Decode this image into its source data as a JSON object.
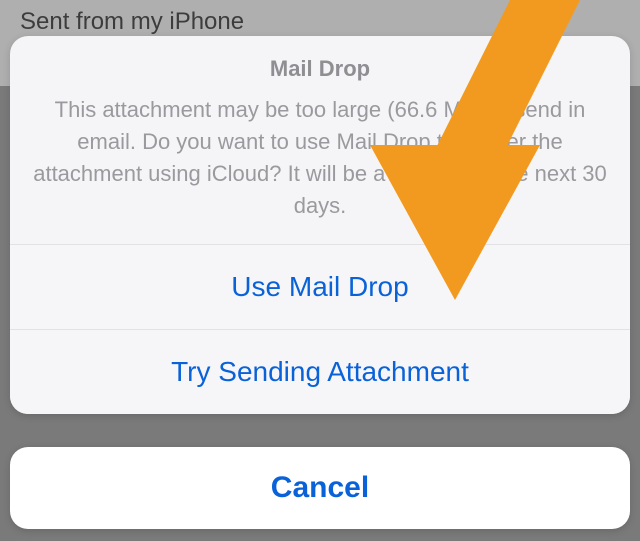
{
  "email": {
    "signature": "Sent from my iPhone"
  },
  "dialog": {
    "title": "Mail Drop",
    "message": "This attachment may be too large (66.6 MB) to send in email. Do you want to use Mail Drop to deliver the attachment using iCloud? It will be available for the next 30 days.",
    "actions": {
      "use_mail_drop": "Use Mail Drop",
      "try_sending": "Try Sending Attachment",
      "cancel": "Cancel"
    }
  },
  "annotation": {
    "arrow_color": "#f29a1f"
  }
}
